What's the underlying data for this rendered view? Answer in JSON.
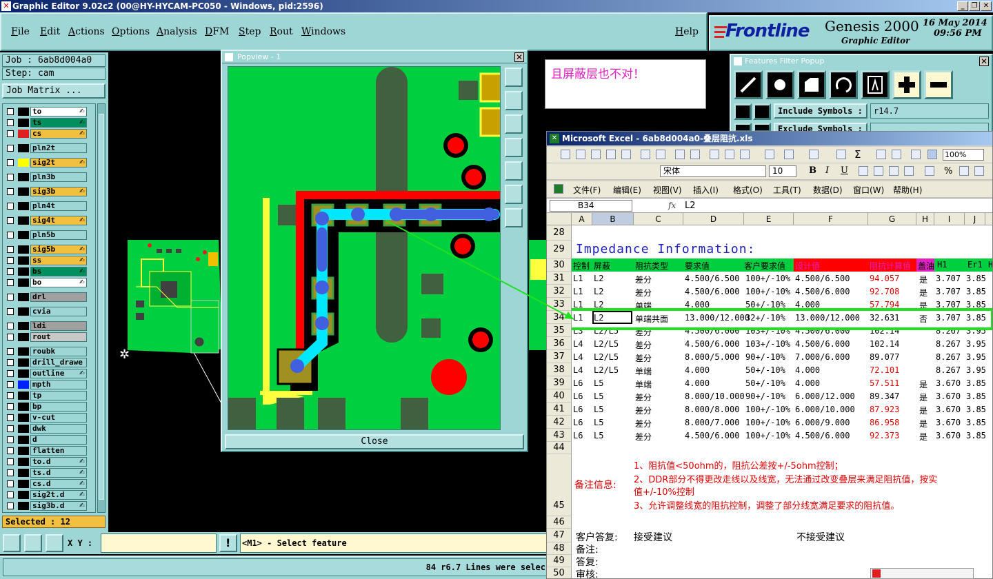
{
  "window": {
    "title": "Graphic Editor 9.02c2 (00@HY-HYCAM-PC050 - Windows, pid:2596)",
    "minimize": "_",
    "restore": "❐",
    "close": "✕"
  },
  "menu": {
    "items": [
      "File",
      "Edit",
      "Actions",
      "Options",
      "Analysis",
      "DFM",
      "Step",
      "Rout",
      "Windows"
    ],
    "help": "Help"
  },
  "logo": {
    "brand": "Frontline",
    "product": "Genesis 2000",
    "subtitle": "Graphic Editor",
    "date": "16 May 2014",
    "time": "09:56 PM"
  },
  "left": {
    "job": "Job : 6ab8d004a0",
    "step": "Step: cam",
    "matrix_button": "Job Matrix ...",
    "selected": "Selected : 12",
    "layers": [
      {
        "name": "to",
        "color": "#000000",
        "bg": "#ffffff",
        "mark": "✍"
      },
      {
        "name": "ts",
        "color": "#000000",
        "bg": "#009060",
        "mark": "✍"
      },
      {
        "name": "cs",
        "color": "#e02020",
        "bg": "#f2c040",
        "mark": "✍"
      },
      {
        "name": "pln2t",
        "color": "#000000",
        "bg": "#9ed6d6",
        "mark": ""
      },
      {
        "name": "sig2t",
        "color": "#ffff00",
        "bg": "#f2c040",
        "mark": "✍"
      },
      {
        "name": "pln3b",
        "color": "#000000",
        "bg": "#9ed6d6",
        "mark": ""
      },
      {
        "name": "sig3b",
        "color": "#000000",
        "bg": "#f2c040",
        "mark": "✍"
      },
      {
        "name": "pln4t",
        "color": "#000000",
        "bg": "#9ed6d6",
        "mark": ""
      },
      {
        "name": "sig4t",
        "color": "#000000",
        "bg": "#f2c040",
        "mark": "✍"
      },
      {
        "name": "pln5b",
        "color": "#000000",
        "bg": "#9ed6d6",
        "mark": ""
      },
      {
        "name": "sig5b",
        "color": "#000000",
        "bg": "#f2c040",
        "mark": "✍"
      },
      {
        "name": "ss",
        "color": "#000000",
        "bg": "#f2c040",
        "mark": "✍"
      },
      {
        "name": "bs",
        "color": "#000000",
        "bg": "#009060",
        "mark": "✍"
      },
      {
        "name": "bo",
        "color": "#000000",
        "bg": "#ffffff",
        "mark": "✍"
      },
      {
        "name": "drl",
        "color": "#000000",
        "bg": "#a0a0a0",
        "mark": ""
      },
      {
        "name": "cvia",
        "color": "#000000",
        "bg": "#9ed6d6",
        "mark": ""
      },
      {
        "name": "ldi",
        "color": "#000000",
        "bg": "#a0a0a0",
        "mark": ""
      },
      {
        "name": "rout",
        "color": "#000000",
        "bg": "#c8c8c8",
        "mark": ""
      },
      {
        "name": "roubk",
        "color": "#000000",
        "bg": "#9ed6d6",
        "mark": ""
      },
      {
        "name": "drill_drawe",
        "color": "#000000",
        "bg": "#9ed6d6",
        "mark": ""
      },
      {
        "name": "outline",
        "color": "#000000",
        "bg": "#9ed6d6",
        "mark": "✍"
      },
      {
        "name": "mpth",
        "color": "#0020ff",
        "bg": "#9ed6d6",
        "mark": ""
      },
      {
        "name": "tp",
        "color": "#000000",
        "bg": "#9ed6d6",
        "mark": ""
      },
      {
        "name": "bp",
        "color": "#000000",
        "bg": "#9ed6d6",
        "mark": ""
      },
      {
        "name": "v-cut",
        "color": "#000000",
        "bg": "#9ed6d6",
        "mark": ""
      },
      {
        "name": "dwk",
        "color": "#000000",
        "bg": "#9ed6d6",
        "mark": ""
      },
      {
        "name": "d",
        "color": "#000000",
        "bg": "#9ed6d6",
        "mark": ""
      },
      {
        "name": "flatten",
        "color": "#000000",
        "bg": "#9ed6d6",
        "mark": ""
      },
      {
        "name": "to.d",
        "color": "#000000",
        "bg": "#9ed6d6",
        "mark": "✍"
      },
      {
        "name": "ts.d",
        "color": "#000000",
        "bg": "#9ed6d6",
        "mark": "✍"
      },
      {
        "name": "cs.d",
        "color": "#000000",
        "bg": "#9ed6d6",
        "mark": "✍"
      },
      {
        "name": "sig2t.d",
        "color": "#000000",
        "bg": "#9ed6d6",
        "mark": "✍"
      },
      {
        "name": "sig3b.d",
        "color": "#000000",
        "bg": "#9ed6d6",
        "mark": "✍"
      }
    ]
  },
  "bottom": {
    "xy_label": "X Y :",
    "prompt": "<M1> - Select feature",
    "status": "84 r6.7 Lines were selec"
  },
  "popview": {
    "title": "Popview - 1",
    "close_x": "✕",
    "close_button": "Close"
  },
  "note": {
    "text": "且屏蔽层也不对！"
  },
  "features_filter": {
    "title": "Features Filter Popup",
    "include_label": "Include Symbols :",
    "include_value": "r14.7",
    "exclude_label": "Exclude Symbols :",
    "close_x": "✕"
  },
  "excel": {
    "title": "Microsoft Excel - 6ab8d004a0-叠层阻抗.xls",
    "font": "宋体",
    "size": "10",
    "zoom": "100%",
    "bold": "B",
    "italic": "I",
    "underline": "U",
    "percent": "%",
    "menus": [
      "文件(F)",
      "编辑(E)",
      "视图(V)",
      "插入(I)",
      "格式(O)",
      "工具(T)",
      "数据(D)",
      "窗口(W)",
      "帮助(H)"
    ],
    "namebox": "B34",
    "fx": "fx",
    "formula": "L2",
    "columns": [
      "A",
      "B",
      "C",
      "D",
      "E",
      "F",
      "G",
      "H",
      "I",
      "J"
    ],
    "section_title": "Impedance Information:",
    "header_row": [
      "控制",
      "屏蔽",
      "阻抗类型",
      "要求值",
      "客户要求值",
      "设计值",
      "阻抗计算值",
      "盖油",
      "H1",
      "Er1",
      "H"
    ],
    "rows": [
      {
        "n": "31",
        "c": [
          "L1",
          "L2",
          "差分",
          "4.500/6.500",
          "100+/-10%",
          "4.500/6.500",
          "94.057",
          "是",
          "3.707",
          "3.85"
        ],
        "red": true
      },
      {
        "n": "32",
        "c": [
          "L1",
          "L2",
          "差分",
          "4.500/6.000",
          "100+/-10%",
          "4.500/6.000",
          "92.708",
          "是",
          "3.707",
          "3.85"
        ],
        "red": true
      },
      {
        "n": "33",
        "c": [
          "L1",
          "L2",
          "单端",
          "4.000",
          "50+/-10%",
          "4.000",
          "57.794",
          "是",
          "3.707",
          "3.85"
        ],
        "red": true
      },
      {
        "n": "34",
        "c": [
          "L1",
          "L2",
          "单端共面",
          "13.000/12.000",
          "32+/-10%",
          "13.000/12.000",
          "32.631",
          "否",
          "3.707",
          "3.85"
        ],
        "red": false
      },
      {
        "n": "35",
        "c": [
          "L3",
          "L2/L5",
          "差分",
          "4.500/6.000",
          "103+/-10%",
          "4.500/6.000",
          "102.14",
          "",
          "8.267",
          "3.95"
        ],
        "red": false
      },
      {
        "n": "36",
        "c": [
          "L4",
          "L2/L5",
          "差分",
          "4.500/6.000",
          "103+/-10%",
          "4.500/6.000",
          "102.14",
          "",
          "8.267",
          "3.95"
        ],
        "red": false
      },
      {
        "n": "37",
        "c": [
          "L4",
          "L2/L5",
          "差分",
          "8.000/5.000",
          "90+/-10%",
          "7.000/6.000",
          "89.077",
          "",
          "8.267",
          "3.95"
        ],
        "red": false
      },
      {
        "n": "38",
        "c": [
          "L4",
          "L2/L5",
          "单端",
          "4.000",
          "50+/-10%",
          "4.000",
          "72.101",
          "",
          "8.267",
          "3.95"
        ],
        "red": true
      },
      {
        "n": "39",
        "c": [
          "L6",
          "L5",
          "单端",
          "4.000",
          "50+/-10%",
          "4.000",
          "57.511",
          "是",
          "3.670",
          "3.85"
        ],
        "red": true
      },
      {
        "n": "40",
        "c": [
          "L6",
          "L5",
          "差分",
          "8.000/10.000",
          "90+/-10%",
          "6.000/12.000",
          "89.347",
          "是",
          "3.670",
          "3.85"
        ],
        "red": false
      },
      {
        "n": "41",
        "c": [
          "L6",
          "L5",
          "差分",
          "8.000/8.000",
          "100+/-10%",
          "6.000/10.000",
          "87.923",
          "是",
          "3.670",
          "3.85"
        ],
        "red": true
      },
      {
        "n": "42",
        "c": [
          "L6",
          "L5",
          "差分",
          "8.000/7.000",
          "100+/-10%",
          "6.000/9.000",
          "86.958",
          "是",
          "3.670",
          "3.85"
        ],
        "red": true
      },
      {
        "n": "43",
        "c": [
          "L6",
          "L5",
          "差分",
          "4.500/6.000",
          "100+/-10%",
          "4.500/6.000",
          "92.373",
          "是",
          "3.670",
          "3.85"
        ],
        "red": true
      }
    ],
    "remarks_label": "备注信息:",
    "remarks": [
      "1、阻抗值<50ohm的，阻抗公差按+/-5ohm控制；",
      "2、DDR部分不得更改走线以及线宽，无法通过改变叠层来满足阻抗值，按实",
      "值+/-10%控制",
      "3、允许调整线宽的阻抗控制，调整了部分线宽满足要求的阻抗值。"
    ],
    "reply_label": "客户答复:",
    "accept": "接受建议",
    "reject": "不接受建议",
    "note_label": "备注:",
    "answer_label": "答复:",
    "review_label": "审核:",
    "row_numbers": [
      "28",
      "29",
      "30",
      "44",
      "45",
      "46",
      "47",
      "48",
      "49",
      "50"
    ]
  }
}
